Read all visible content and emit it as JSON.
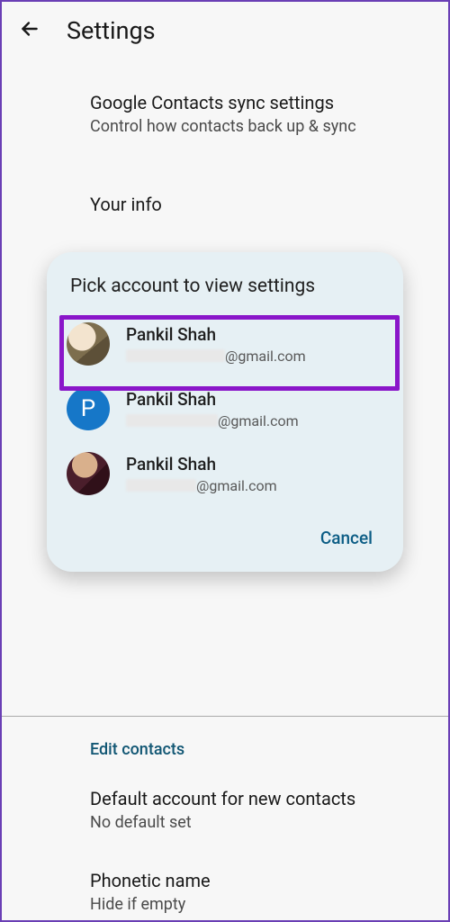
{
  "topbar": {
    "title": "Settings"
  },
  "bg": {
    "sync_title": "Google Contacts sync settings",
    "sync_sub": "Control how contacts back up & sync",
    "your_info": "Your info",
    "edit_contacts": "Edit contacts",
    "default_title": "Default account for new contacts",
    "default_sub": "No default set",
    "phonetic_title": "Phonetic name",
    "phonetic_sub": "Hide if empty"
  },
  "modal": {
    "title": "Pick account to view settings",
    "cancel": "Cancel",
    "accounts": [
      {
        "name": "Pankil Shah",
        "email_suffix": "@gmail.com",
        "avatar": "photo1",
        "letter": ""
      },
      {
        "name": "Pankil Shah",
        "email_suffix": "@gmail.com",
        "avatar": "letter",
        "letter": "P"
      },
      {
        "name": "Pankil Shah",
        "email_suffix": "@gmail.com",
        "avatar": "photo2",
        "letter": ""
      }
    ]
  }
}
